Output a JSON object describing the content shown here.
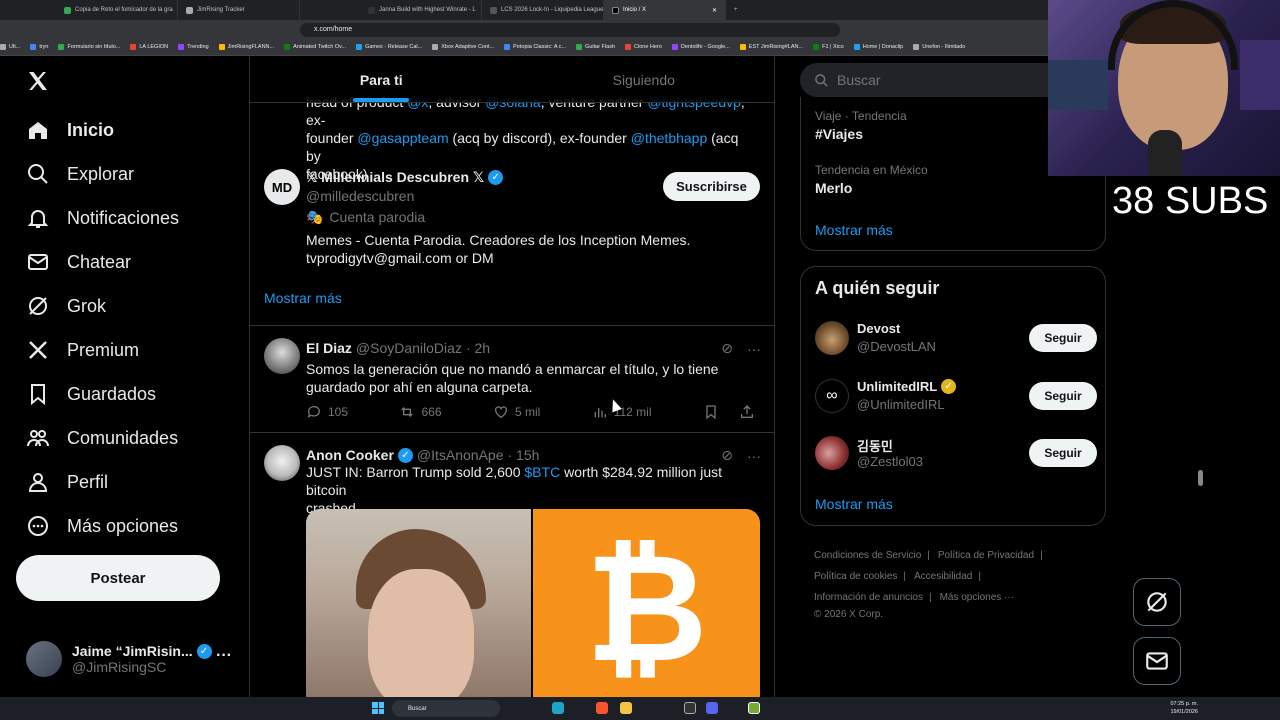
{
  "browser": {
    "tabs": [
      {
        "label": "Copia de Reto el fomicador de la gra"
      },
      {
        "label": "JimRising Tracker"
      },
      {
        "label": "Janna Build with Highest Winrate - L"
      },
      {
        "label": "LCS 2026 Lock-In - Liquipedia League"
      },
      {
        "label": "Inicio / X"
      }
    ],
    "url": "x.com/home",
    "bookmarks": [
      "Ult...",
      "tryn",
      "Formulario sin título...",
      "LA LEGION",
      "Trending",
      "JimRisingFLANN...",
      "Animated Twitch Ov...",
      "Games - Release Cal...",
      "Xbox Adaptive Cont...",
      "Petopia Classic: A c...",
      "Guitar Flash",
      "Clone Hero",
      "Dentolife - Google...",
      "EST JimRising#LAN...",
      "F1 | Xico",
      "Home | Donaclip",
      "Unefon - Ilimitado"
    ]
  },
  "nav": {
    "items": [
      {
        "label": "Inicio",
        "icon": "home-icon"
      },
      {
        "label": "Explorar",
        "icon": "search-icon"
      },
      {
        "label": "Notificaciones",
        "icon": "bell-icon"
      },
      {
        "label": "Chatear",
        "icon": "mail-icon"
      },
      {
        "label": "Grok",
        "icon": "grok-icon"
      },
      {
        "label": "Premium",
        "icon": "x-icon"
      },
      {
        "label": "Guardados",
        "icon": "bookmark-icon"
      },
      {
        "label": "Comunidades",
        "icon": "people-icon"
      },
      {
        "label": "Perfil",
        "icon": "person-icon"
      },
      {
        "label": "Más opciones",
        "icon": "more-circle-icon"
      }
    ],
    "post_label": "Postear",
    "account": {
      "name": "Jaime “JimRisin...",
      "handle": "@JimRisingSC",
      "more": "···"
    }
  },
  "timeline": {
    "tabs": [
      {
        "label": "Para ti"
      },
      {
        "label": "Siguiendo"
      }
    ],
    "prev_bio": {
      "l1a": "head of product ",
      "l1b": "@x",
      "l1c": ", advisor ",
      "l1d": "@solana",
      "l1e": ", venture partner ",
      "l1f": "@tightspeedvp",
      "l1g": ", ex-",
      "l2a": "founder ",
      "l2b": "@gasappteam",
      "l2c": " (acq by discord), ex-founder ",
      "l2d": "@thetbhapp",
      "l2e": " (acq by",
      "l3": "facebook)"
    },
    "suggestion": {
      "name": "𝕏 Millennials Descubren 𝕏",
      "handle": "@milledescubren",
      "parody": "Cuenta parodia",
      "bio1": "Memes - Cuenta Parodia. Creadores de los Inception Memes.",
      "bio2": "tvprodigytv@gmail.com or DM",
      "button": "Suscribirse"
    },
    "show_more": "Mostrar más",
    "tweets": [
      {
        "name": "El Diaz",
        "handle": "@SoyDaniloDiaz",
        "time": "· 2h",
        "text1": "Somos la generación que no mandó a enmarcar el título, y lo tiene",
        "text2": "guardado por ahí en alguna carpeta.",
        "replies": "105",
        "retweets": "666",
        "likes": "5 mil",
        "views": "112 mil"
      },
      {
        "name": "Anon Cooker",
        "handle": "@ItsAnonApe",
        "time": "· 15h",
        "text1a": "JUST IN: Barron Trump sold 2,600 ",
        "text1b": "$BTC",
        "text1c": " worth $284.92 million just bitcoin",
        "text2": "crashed.",
        "btc_symbol": "₿"
      }
    ]
  },
  "right": {
    "search_placeholder": "Buscar",
    "trends": [
      {
        "category": "Viaje · Tendencia",
        "title": "#Viajes"
      },
      {
        "category": "Tendencia en México",
        "title": "Merlo"
      }
    ],
    "trends_more": "Mostrar más",
    "who_to_follow": {
      "title": "A quién seguir",
      "items": [
        {
          "name": "Devost",
          "handle": "@DevostLAN",
          "button": "Seguir"
        },
        {
          "name": "UnlimitedIRL",
          "handle": "@UnlimitedIRL",
          "button": "Seguir"
        },
        {
          "name": "김동민",
          "handle": "@Zestlol03",
          "button": "Seguir"
        }
      ],
      "more": "Mostrar más"
    },
    "footer": {
      "terms": "Condiciones de Servicio",
      "privacy": "Política de Privacidad",
      "cookies": "Política de cookies",
      "access": "Accesibilidad",
      "ads": "Información de anuncios",
      "more": "Más opciones ···",
      "copy": "© 2026 X Corp."
    }
  },
  "overlay": {
    "subs": "38 SUBS"
  },
  "taskbar": {
    "search": "Buscar",
    "time": "07:25 p. m.",
    "date": "19/01/2026"
  },
  "colors": {
    "accent": "#1d9bf0",
    "background": "#000000",
    "border": "#2f3336",
    "muted": "#71767b",
    "bitcoin": "#f7931a"
  }
}
